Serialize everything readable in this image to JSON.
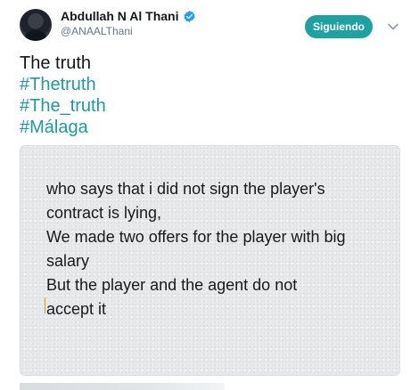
{
  "header": {
    "display_name": "Abdullah N Al Thani",
    "handle": "@ANAALThani",
    "follow_label": "Siguiendo",
    "verified_icon": "verified-badge-icon",
    "menu_icon": "chevron-down-icon"
  },
  "tweet": {
    "lines": [
      "The truth",
      "#Thetruth",
      "#The_truth",
      "#Málaga"
    ]
  },
  "image_text": {
    "lines": [
      "who says that i  did not sign the player's",
      "contract is lying,",
      "We made two offers for the player with big",
      "salary",
      "But the player and the agent do not",
      "accept it"
    ]
  },
  "colors": {
    "accent": "#1da1a1",
    "hashtag": "#1d9b9b",
    "verified": "#1da1f2"
  }
}
